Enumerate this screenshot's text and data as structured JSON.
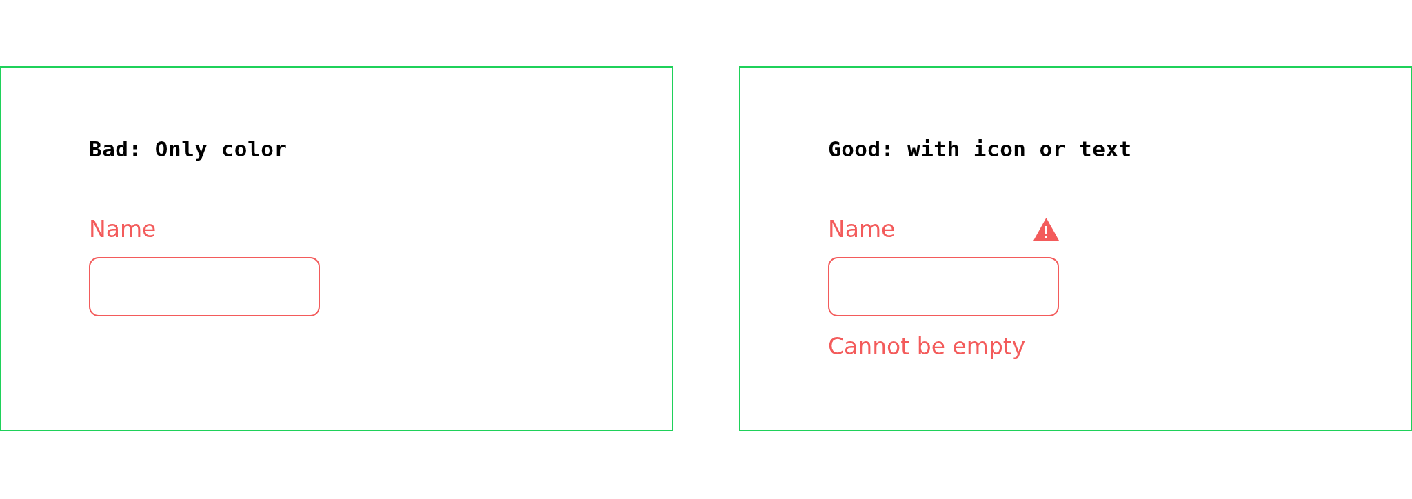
{
  "panels": [
    {
      "title": "Bad: Only color",
      "field": {
        "label": "Name",
        "invalid": true,
        "warning_icon": false
      }
    },
    {
      "title": "Good: with icon or text",
      "field": {
        "label": "Name",
        "invalid": true,
        "warning_icon": true,
        "error": "Cannot be empty"
      }
    }
  ]
}
